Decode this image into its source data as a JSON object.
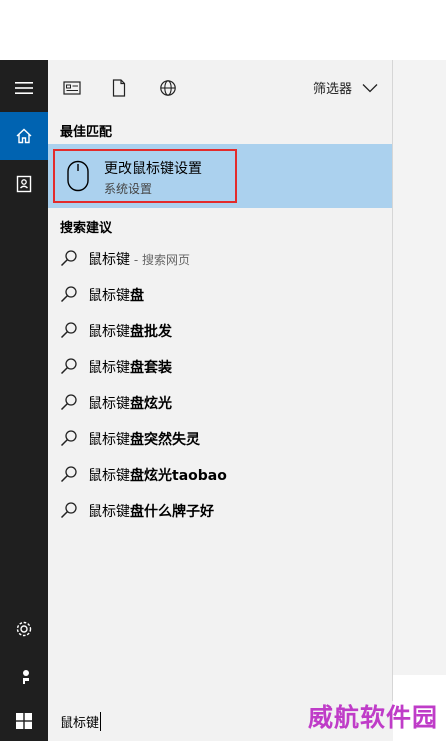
{
  "filter": {
    "label": "筛选器"
  },
  "best_match": {
    "heading": "最佳匹配",
    "title": "更改鼠标键设置",
    "subtitle": "系统设置"
  },
  "suggestions_heading": "搜索建议",
  "suggestions": [
    {
      "prefix": "鼠标键",
      "bold": "",
      "suffix": " - 搜索网页"
    },
    {
      "prefix": "鼠标键",
      "bold": "盘",
      "suffix": ""
    },
    {
      "prefix": "鼠标键",
      "bold": "盘批发",
      "suffix": ""
    },
    {
      "prefix": "鼠标键",
      "bold": "盘套装",
      "suffix": ""
    },
    {
      "prefix": "鼠标键",
      "bold": "盘炫光",
      "suffix": ""
    },
    {
      "prefix": "鼠标键",
      "bold": "盘突然失灵",
      "suffix": ""
    },
    {
      "prefix": "鼠标键",
      "bold": "盘炫光taobao",
      "suffix": ""
    },
    {
      "prefix": "鼠标键",
      "bold": "盘什么牌子好",
      "suffix": ""
    }
  ],
  "search": {
    "value": "鼠标键"
  },
  "watermark": "威航软件园",
  "colors": {
    "accent": "#0063b1",
    "highlight": "#abd1ee",
    "outline": "#e32b2b",
    "rail": "#1f1f1f"
  }
}
